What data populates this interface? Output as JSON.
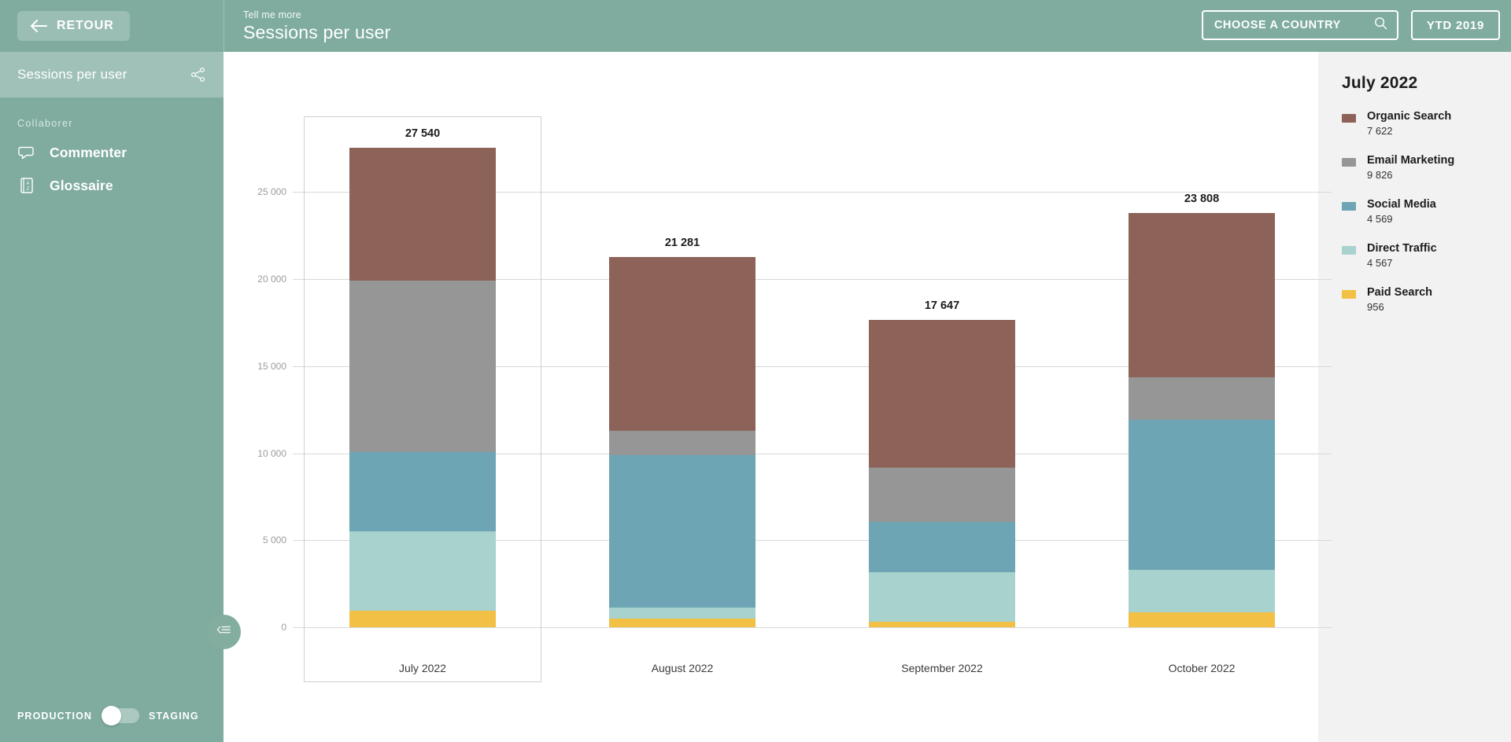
{
  "sidebar": {
    "back_button": "RETOUR",
    "panel_title": "Sessions per user",
    "share_icon": "share-icon",
    "section_label": "Collaborer",
    "items": [
      {
        "label": "Commenter",
        "icon": "comment-bubble-icon"
      },
      {
        "label": "Glossaire",
        "icon": "az-dictionary-icon"
      }
    ],
    "env_left": "PRODUCTION",
    "env_right": "STAGING",
    "env_selected": "PRODUCTION",
    "collapse_icon": "collapse-sidebar-icon"
  },
  "header": {
    "eyebrow": "Tell me more",
    "title": "Sessions per user",
    "country_select": "CHOOSE A COUNTRY",
    "search_icon": "search-icon",
    "period_button": "YTD 2019"
  },
  "legend": {
    "title": "July 2022",
    "items": [
      {
        "name": "Organic Search",
        "value": "7 622",
        "color": "#8d6258"
      },
      {
        "name": "Email Marketing",
        "value": "9 826",
        "color": "#969696"
      },
      {
        "name": "Social Media",
        "value": "4 569",
        "color": "#6da5b4"
      },
      {
        "name": "Direct Traffic",
        "value": "4 567",
        "color": "#a8d2cd"
      },
      {
        "name": "Paid Search",
        "value": "956",
        "color": "#f2c044"
      }
    ]
  },
  "chart_data": {
    "type": "bar",
    "stacked": true,
    "title": "Sessions per user",
    "xlabel": "",
    "ylabel": "",
    "categories": [
      "July 2022",
      "August 2022",
      "September 2022",
      "October 2022"
    ],
    "ytick_labels": [
      "0",
      "5 000",
      "10 000",
      "15 000",
      "20 000",
      "25 000"
    ],
    "ytick_values": [
      0,
      5000,
      10000,
      15000,
      20000,
      25000
    ],
    "ylim": [
      0,
      28000
    ],
    "grid": true,
    "legend_position": "right",
    "selected_category": "July 2022",
    "totals": [
      "27 540",
      "21 281",
      "17 647",
      "23 808"
    ],
    "total_values": [
      27540,
      21281,
      17647,
      23808
    ],
    "series": [
      {
        "name": "Paid Search",
        "color": "#f2c044",
        "values": [
          956,
          480,
          300,
          840
        ]
      },
      {
        "name": "Direct Traffic",
        "color": "#a8d2cd",
        "values": [
          4567,
          640,
          2870,
          2480
        ]
      },
      {
        "name": "Social Media",
        "color": "#6da5b4",
        "values": [
          4569,
          8760,
          2900,
          8600
        ]
      },
      {
        "name": "Email Marketing",
        "color": "#969696",
        "values": [
          9826,
          1400,
          3080,
          2440
        ]
      },
      {
        "name": "Organic Search",
        "color": "#8d6258",
        "values": [
          7622,
          10001,
          8497,
          9448
        ]
      }
    ]
  }
}
